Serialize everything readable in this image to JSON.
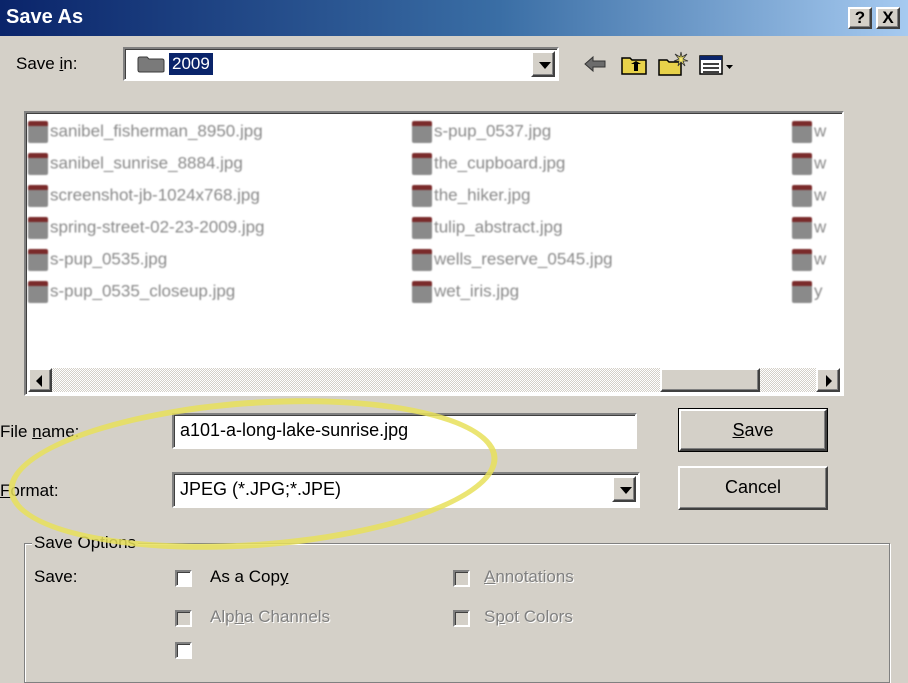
{
  "window": {
    "title": "Save As",
    "help_button": "?",
    "close_button": "X"
  },
  "savein": {
    "label_prefix": "Save ",
    "label_access": "i",
    "label_suffix": "n:",
    "value": "2009"
  },
  "toolbar": {
    "icons": [
      "back-arrow-icon",
      "up-folder-icon",
      "new-folder-icon",
      "view-menu-icon"
    ]
  },
  "files": {
    "column1": [
      "sanibel_fisherman_8950.jpg",
      "sanibel_sunrise_8884.jpg",
      "screenshot-jb-1024x768.jpg",
      "spring-street-02-23-2009.jpg",
      "s-pup_0535.jpg",
      "s-pup_0535_closeup.jpg"
    ],
    "column2": [
      "s-pup_0537.jpg",
      "the_cupboard.jpg",
      "the_hiker.jpg",
      "tulip_abstract.jpg",
      "wells_reserve_0545.jpg",
      "wet_iris.jpg"
    ],
    "column3": [
      "w",
      "w",
      "w",
      "w",
      "w",
      "y"
    ]
  },
  "filename": {
    "label_prefix": "File ",
    "label_access": "n",
    "label_suffix": "ame:",
    "value": "a101-a-long-lake-sunrise.jpg"
  },
  "format": {
    "label_access": "F",
    "label_suffix": "ormat:",
    "value": "JPEG (*.JPG;*.JPE)"
  },
  "buttons": {
    "save_access": "S",
    "save_suffix": "ave",
    "cancel": "Cancel"
  },
  "options": {
    "group_label": "Save Options",
    "save_label": "Save:",
    "as_copy_prefix": "As a Cop",
    "as_copy_access": "y",
    "annotations_access": "A",
    "annotations_suffix": "nnotations",
    "alpha_prefix": "Alp",
    "alpha_access": "h",
    "alpha_suffix": "a Channels",
    "spot_prefix": "S",
    "spot_access": "p",
    "spot_suffix": "ot Colors"
  },
  "colors": {
    "title_bar": "#0a246a",
    "selection": "#0a246a",
    "highlight_circle": "#e8e05a",
    "face": "#d4d0c8"
  }
}
